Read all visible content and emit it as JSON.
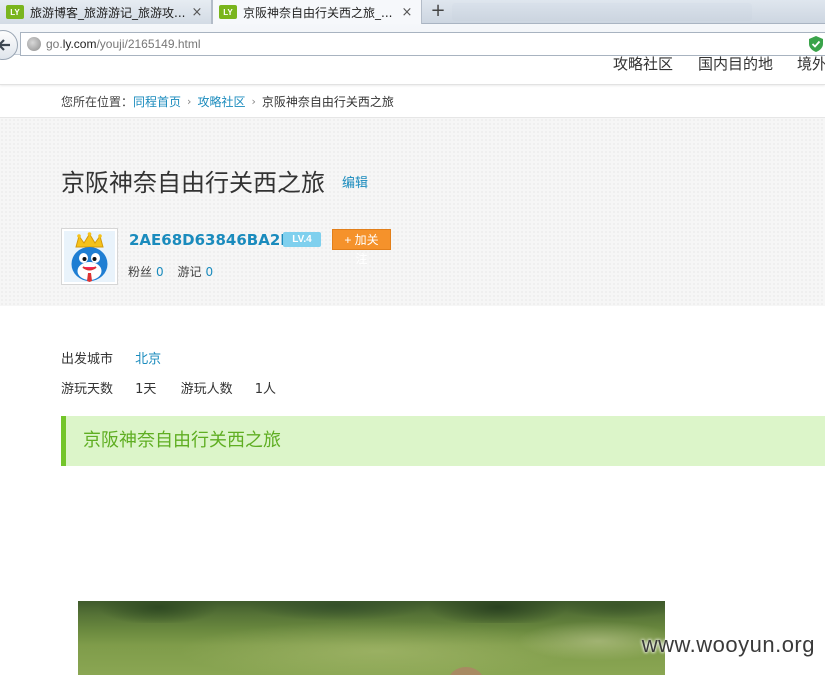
{
  "browser": {
    "tabs": [
      {
        "favicon": "LY",
        "title": "旅游博客_旅游游记_旅游攻...",
        "close": "×",
        "active": false
      },
      {
        "favicon": "LY",
        "title": "京阪神奈自由行关西之旅_...",
        "close": "×",
        "active": true
      }
    ],
    "new_tab": "+",
    "url": {
      "host_prefix": "go.",
      "host_domain": "ly.com",
      "path": "/youji/2165149.html"
    },
    "back_icon": "back-arrow-icon",
    "security_icon": "shield-check-icon",
    "accent": "#7ab51d"
  },
  "site_nav": {
    "items": [
      "攻略社区",
      "国内目的地",
      "境外"
    ]
  },
  "breadcrumb": {
    "prefix": "您所在位置：",
    "items": [
      "同程首页",
      "攻略社区"
    ],
    "separator": "›",
    "current": "京阪神奈自由行关西之旅"
  },
  "article": {
    "title": "京阪神奈自由行关西之旅",
    "edit_label": "编辑"
  },
  "author": {
    "name": "2AE68D63846BA2F9",
    "level": "LV.4",
    "follow_label": "+ 加关注",
    "fans_label": "粉丝",
    "fans_count": "0",
    "notes_label": "游记",
    "notes_count": "0",
    "avatar_icon": "crowned-mascot-avatar"
  },
  "trip": {
    "depart_label": "出发城市",
    "depart_value": "北京",
    "days_label": "游玩天数",
    "days_value": "1天",
    "people_label": "游玩人数",
    "people_value": "1人"
  },
  "section": {
    "heading": "京阪神奈自由行关西之旅",
    "color": "#5fae22",
    "bg": "#dcf5c9"
  },
  "links_color": "#1a8bbd",
  "watermark": "www.wooyun.org"
}
